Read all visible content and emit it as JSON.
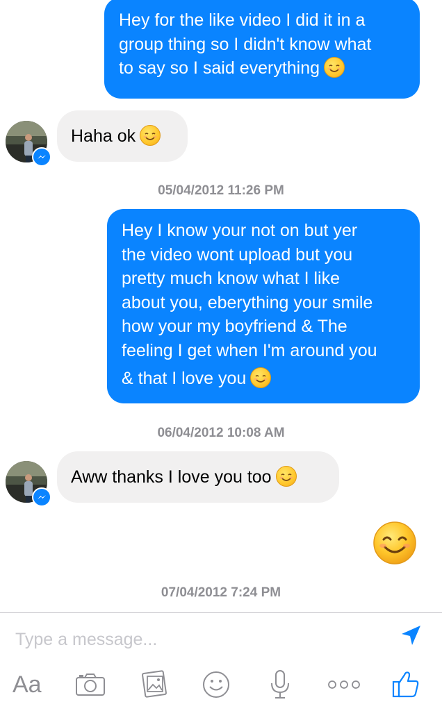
{
  "messages": [
    {
      "direction": "outgoing",
      "lines": [
        "Hey for the like video I did it in a",
        "group thing so I didn't know what",
        "to say so I said everything"
      ],
      "emoji": "smiling-face-emoji"
    },
    {
      "direction": "incoming",
      "text": "Haha ok",
      "emoji": "smiling-face-emoji"
    },
    {
      "direction": "outgoing",
      "lines": [
        "Hey I know your not on but yer",
        "the video wont upload but you",
        "pretty much know what I like",
        "about you, eberything your smile",
        "how your my boyfriend & The",
        "feeling I get when I'm around you",
        "& that I love you"
      ],
      "emoji": "smiling-face-emoji"
    },
    {
      "direction": "incoming",
      "text": "Aww thanks I love you too",
      "emoji": "smiling-face-emoji"
    },
    {
      "direction": "outgoing",
      "emoji_only": "smiling-face-emoji"
    }
  ],
  "timestamps": [
    "05/04/2012 11:26 PM",
    "06/04/2012 10:08 AM",
    "07/04/2012 7:24 PM"
  ],
  "composer": {
    "placeholder": "Type a message...",
    "send_icon": "send-arrow-icon"
  },
  "toolbar": {
    "text_label": "Aa",
    "icons": [
      "text-format-icon",
      "camera-icon",
      "gallery-icon",
      "emoji-icon",
      "microphone-icon",
      "more-icon",
      "like-icon"
    ]
  },
  "colors": {
    "accent": "#0a84ff",
    "incoming_bubble": "#f1f0f0",
    "outgoing_bubble": "#0a84ff",
    "timestamp": "#8e8e93",
    "placeholder": "#c7c7cc",
    "toolbar_icon": "#8e8e93"
  }
}
